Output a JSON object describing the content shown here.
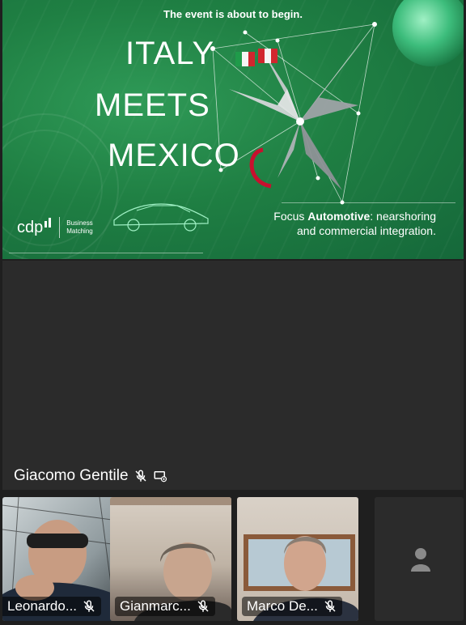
{
  "banner": {
    "headline": "The event is about to begin.",
    "title_lines": [
      "ITALY",
      "MEETS",
      "MEXICO"
    ],
    "focus_prefix": "Focus ",
    "focus_bold": "Automotive",
    "focus_rest": ": nearshoring",
    "focus_line2": "and commercial integration.",
    "logo_word": "cdp",
    "logo_sub_1": "Business",
    "logo_sub_2": "Matching",
    "colors": {
      "green": "#1f7f43",
      "red": "#c8102e"
    }
  },
  "main_speaker": {
    "name": "Giacomo Gentile",
    "icons": [
      "mic-muted-icon",
      "screen-share-icon"
    ]
  },
  "participants": [
    {
      "name": "Leonardo...",
      "muted": true
    },
    {
      "name": "Gianmarc...",
      "muted": true
    },
    {
      "name": "Marco De...",
      "muted": true
    }
  ],
  "empty_tile_icon": "person-icon"
}
